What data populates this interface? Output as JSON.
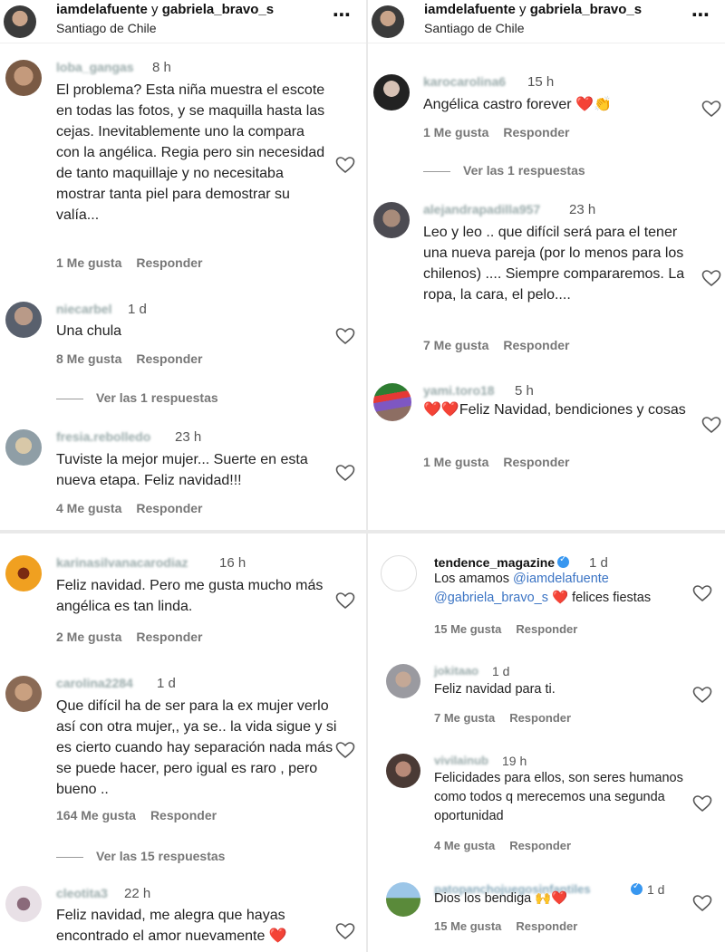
{
  "header": {
    "user1": "iamdelafuente",
    "connector": "y",
    "user2": "gabriela_bravo_s",
    "location": "Santiago de Chile",
    "more_icon": "⋯"
  },
  "p1": {
    "c1": {
      "user": "loba_gangas",
      "time": "8 h",
      "text": "El problema? Esta niña muestra el escote en todas las fotos, y se maquilla hasta las cejas. Inevitablemente uno la compara con la angélica. Regia pero sin necesidad de tanto maquillaje y no necesitaba mostrar tanta piel para demostrar su valía...",
      "likes": "1 Me gusta",
      "reply": "Responder"
    },
    "c2": {
      "user": "niecarbel",
      "time": "1 d",
      "text": "Una chula",
      "likes": "8 Me gusta",
      "reply": "Responder",
      "replies": "Ver las 1 respuestas"
    },
    "c3": {
      "user": "fresia.rebolledo",
      "time": "23 h",
      "text": "Tuviste la mejor mujer... Suerte en esta nueva etapa. Feliz navidad!!!",
      "likes": "4 Me gusta",
      "reply": "Responder"
    }
  },
  "p2": {
    "c1": {
      "user": "karocarolina6",
      "time": "15 h",
      "text": "Angélica castro forever ❤️👏",
      "likes": "1 Me gusta",
      "reply": "Responder",
      "replies": "Ver las 1 respuestas"
    },
    "c2": {
      "user": "alejandrapadilla957",
      "time": "23 h",
      "text": "Leo y leo .. que difícil será para el tener una nueva pareja (por lo menos para los chilenos) .... Siempre compararemos. La ropa, la cara, el pelo....",
      "likes": "7 Me gusta",
      "reply": "Responder"
    },
    "c3": {
      "user": "yami.toro18",
      "time": "5 h",
      "text": "❤️❤️Feliz Navidad, bendiciones y cosas",
      "likes": "1 Me gusta",
      "reply": "Responder"
    }
  },
  "p3": {
    "c1": {
      "user": "karinasilvanacarodiaz",
      "time": "16 h",
      "text": "Feliz navidad. Pero me gusta mucho más angélica es tan linda.",
      "likes": "2 Me gusta",
      "reply": "Responder"
    },
    "c2": {
      "user": "carolina2284",
      "time": "1 d",
      "text": "Que difícil ha de ser para la ex mujer verlo así con otra mujer,, ya se.. la vida sigue y si es cierto cuando hay separación nada más se puede hacer, pero igual es raro , pero bueno ..",
      "likes": "164 Me gusta",
      "reply": "Responder",
      "replies": "Ver las 15 respuestas"
    },
    "c3": {
      "user": "cleotita3",
      "time": "22 h",
      "text": "Feliz navidad, me alegra que hayas encontrado el amor nuevamente ❤️"
    }
  },
  "p4": {
    "c1": {
      "user": "tendence_magazine",
      "time": "1 d",
      "text_a": "Los amamos ",
      "mention1": "@iamdelafuente",
      "mention2": "@gabriela_bravo_s",
      "text_b": " ❤️ felices fiestas",
      "likes": "15 Me gusta",
      "reply": "Responder"
    },
    "c2": {
      "user": "jokitaao",
      "time": "1 d",
      "text": "Feliz navidad para ti.",
      "likes": "7 Me gusta",
      "reply": "Responder"
    },
    "c3": {
      "user": "vivilainub",
      "time": "19 h",
      "text": "Felicidades para ellos, son seres humanos como todos q merecemos una segunda oportunidad",
      "likes": "4 Me gusta",
      "reply": "Responder"
    },
    "c4": {
      "user": "patopanchojuegosinfantiles",
      "time": "1 d",
      "text": "Dios los bendiga 🙌❤️",
      "likes": "15 Me gusta",
      "reply": "Responder"
    }
  },
  "icons": {
    "heart": "heart-outline-icon",
    "verified": "verified-badge-icon"
  }
}
